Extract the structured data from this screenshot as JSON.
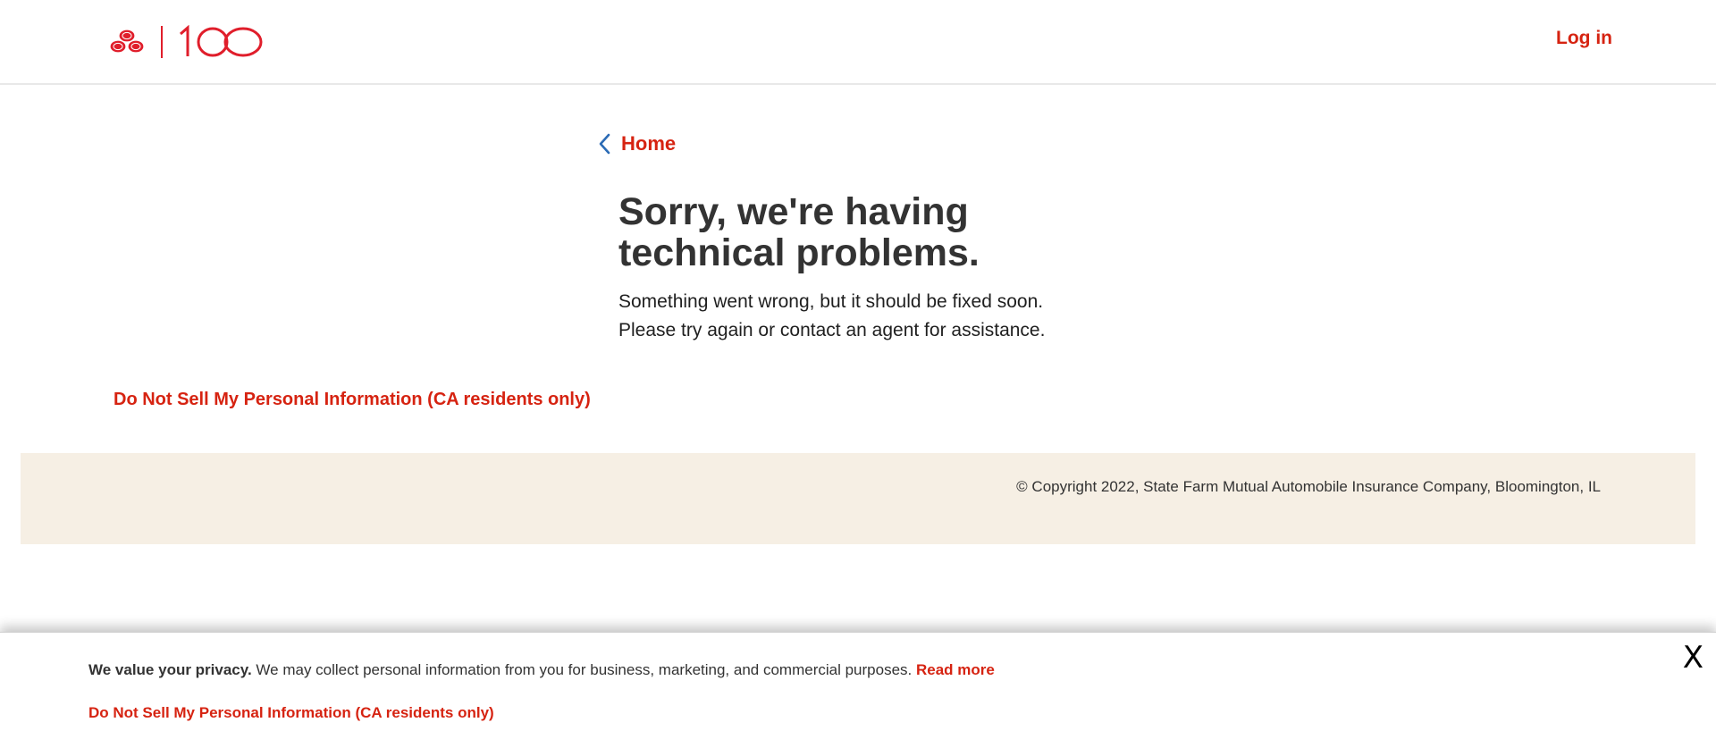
{
  "header": {
    "logo_text": "100",
    "login_label": "Log in"
  },
  "breadcrumb": {
    "label": "Home"
  },
  "error": {
    "title": "Sorry, we're having technical problems.",
    "line1": "Something went wrong, but it should be fixed soon.",
    "line2": "Please try again or contact an agent for assistance."
  },
  "links": {
    "do_not_sell": "Do Not Sell My Personal Information (CA residents only)"
  },
  "footer": {
    "copyright": "© Copyright 2022, State Farm Mutual Automobile Insurance Company, Bloomington, IL"
  },
  "privacy_banner": {
    "bold_text": "We value your privacy.",
    "text": " We may collect personal information from you for business, marketing, and commercial purposes. ",
    "read_more": "Read more",
    "do_not_sell": "Do Not Sell My Personal Information (CA residents only)",
    "close_label": "X"
  },
  "colors": {
    "brand_red": "#d62311",
    "text_dark": "#333333",
    "footer_bg": "#f6efe4",
    "chevron_blue": "#2b6bb5"
  },
  "icons": {
    "logo": "state-farm-rings-logo",
    "back": "chevron-left-icon"
  }
}
